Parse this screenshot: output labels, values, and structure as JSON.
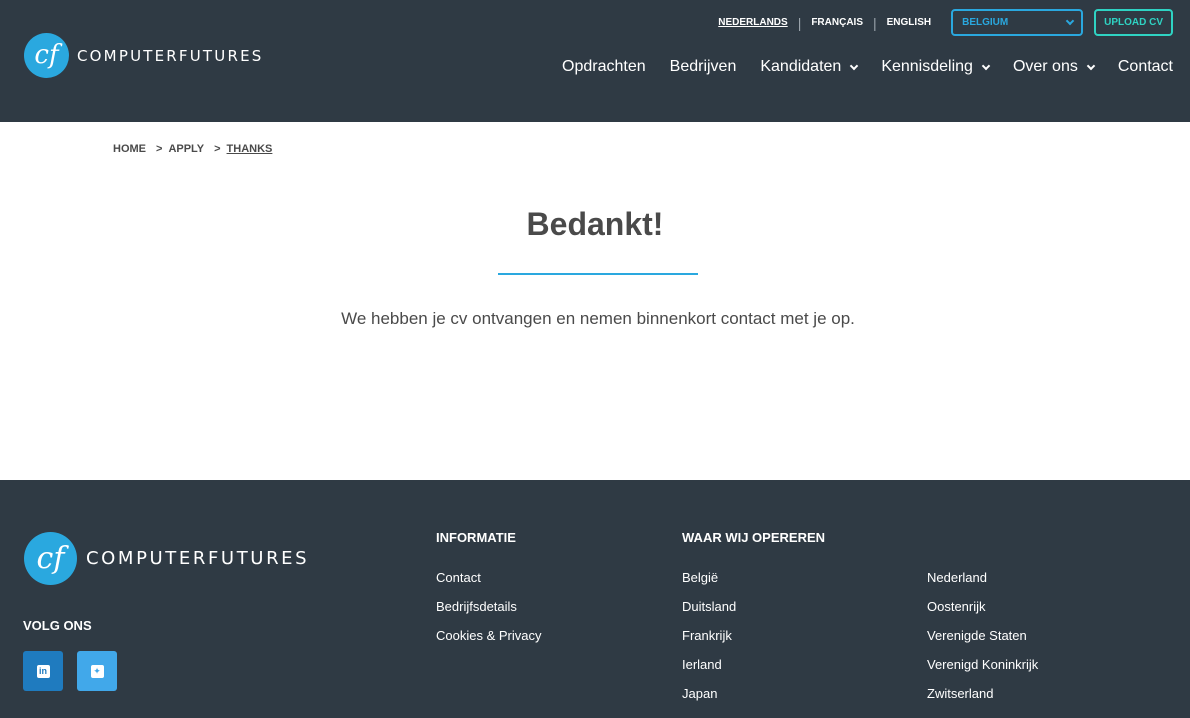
{
  "header": {
    "logo_text": "COMPUTERFUTURES",
    "languages": [
      {
        "label": "NEDERLANDS",
        "active": true
      },
      {
        "label": "FRANÇAIS",
        "active": false
      },
      {
        "label": "ENGLISH",
        "active": false
      }
    ],
    "country_select": "BELGIUM",
    "upload_cv": "UPLOAD CV",
    "nav": [
      {
        "label": "Opdrachten",
        "dropdown": false
      },
      {
        "label": "Bedrijven",
        "dropdown": false
      },
      {
        "label": "Kandidaten",
        "dropdown": true
      },
      {
        "label": "Kennisdeling",
        "dropdown": true
      },
      {
        "label": "Over ons",
        "dropdown": true
      },
      {
        "label": "Contact",
        "dropdown": false
      }
    ]
  },
  "breadcrumb": [
    "HOME",
    "APPLY",
    "THANKS"
  ],
  "breadcrumb_separator": ">",
  "main": {
    "title": "Bedankt!",
    "message": "We hebben je cv ontvangen en nemen binnenkort contact met je op."
  },
  "footer": {
    "logo_text": "COMPUTERFUTURES",
    "follow_label": "VOLG ONS",
    "info_heading": "INFORMATIE",
    "info_links": [
      "Contact",
      "Bedrijfsdetails",
      "Cookies & Privacy"
    ],
    "operate_heading": "WAAR WIJ OPEREREN",
    "countries_col1": [
      "België",
      "Duitsland",
      "Frankrijk",
      "Ierland",
      "Japan"
    ],
    "countries_col2": [
      "Nederland",
      "Oostenrijk",
      "Verenigde Staten",
      "Verenigd Koninkrijk",
      "Zwitserland"
    ]
  },
  "icons": {
    "logo": "cf-logo-icon",
    "country_chevron": "chevron-down-icon",
    "linkedin": "linkedin-icon",
    "twitter": "twitter-icon"
  },
  "colors": {
    "header_bg": "#2f3a44",
    "accent_blue": "#2aa8df",
    "upload_teal": "#2fd3c3",
    "linkedin_blue": "#1f7bbf",
    "twitter_blue": "#41a8ea"
  }
}
